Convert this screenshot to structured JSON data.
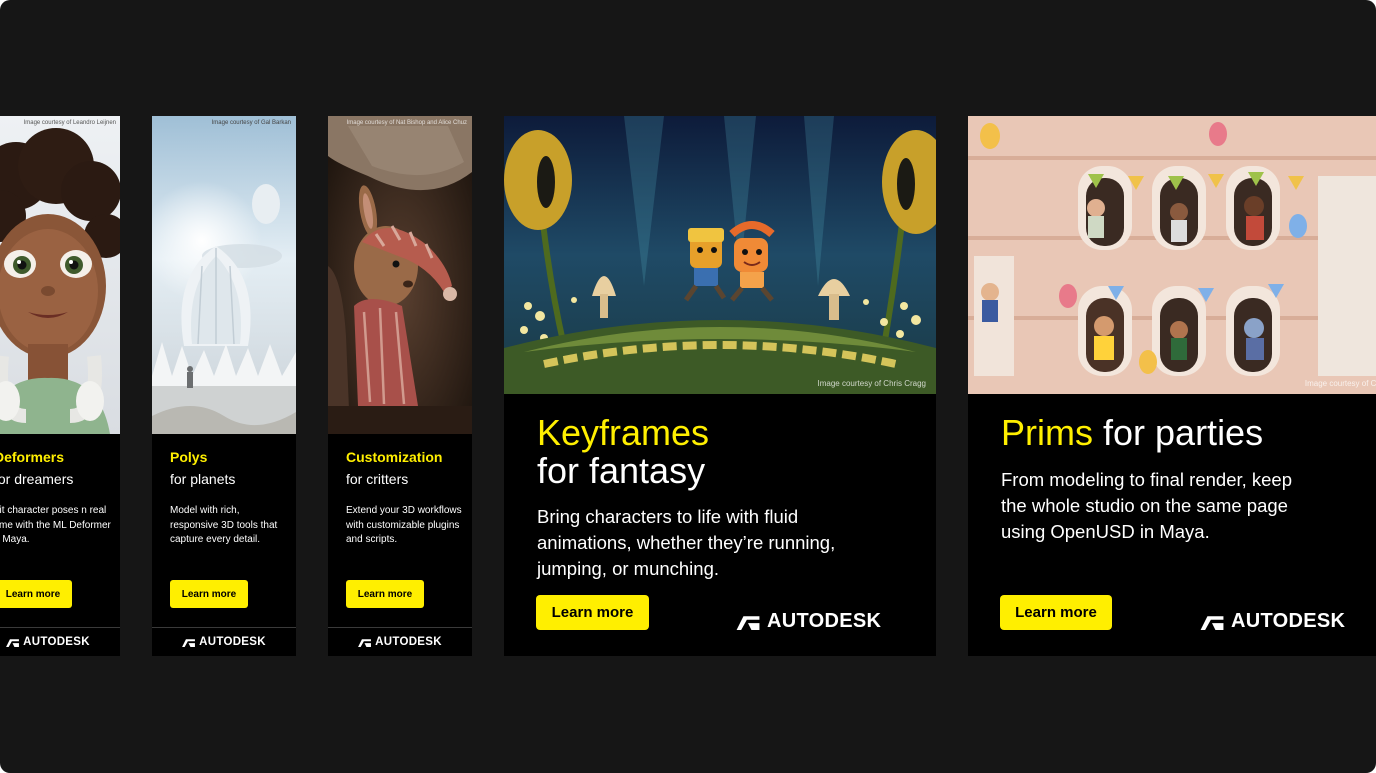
{
  "brand": {
    "name": "AUTODESK",
    "accent": "#ffef00",
    "background": "#161616"
  },
  "ads": [
    {
      "credit": "Image courtesy of Leandro Leijnen",
      "title": "Deformers",
      "subtitle": "for dreamers",
      "desc": "dit character poses n real time with the ML Deformer n Maya.",
      "button": "Learn more"
    },
    {
      "credit": "Image courtesy of Gal Barkan",
      "title": "Polys",
      "subtitle": "for planets",
      "desc": "Model with rich, responsive 3D tools that capture every detail.",
      "button": "Learn more"
    },
    {
      "credit": "Image courtesy of Nat Bishop and Alice Chuz",
      "title": "Customization",
      "subtitle": "for critters",
      "desc": "Extend your 3D workflows with customizable plugins and scripts.",
      "button": "Learn more"
    },
    {
      "credit": "Image courtesy of Chris Cragg",
      "title": "Keyframes",
      "subtitle": "for fantasy",
      "desc": "Bring characters to life with fluid animations, whether they’re running, jumping, or munching.",
      "button": "Learn more"
    },
    {
      "credit": "Image courtesy of Chris Cr",
      "title": "Prims",
      "subtitle": "for parties",
      "desc": "From modeling to final render, keep the whole studio on the same page using OpenUSD in Maya.",
      "button": "Learn more"
    }
  ]
}
